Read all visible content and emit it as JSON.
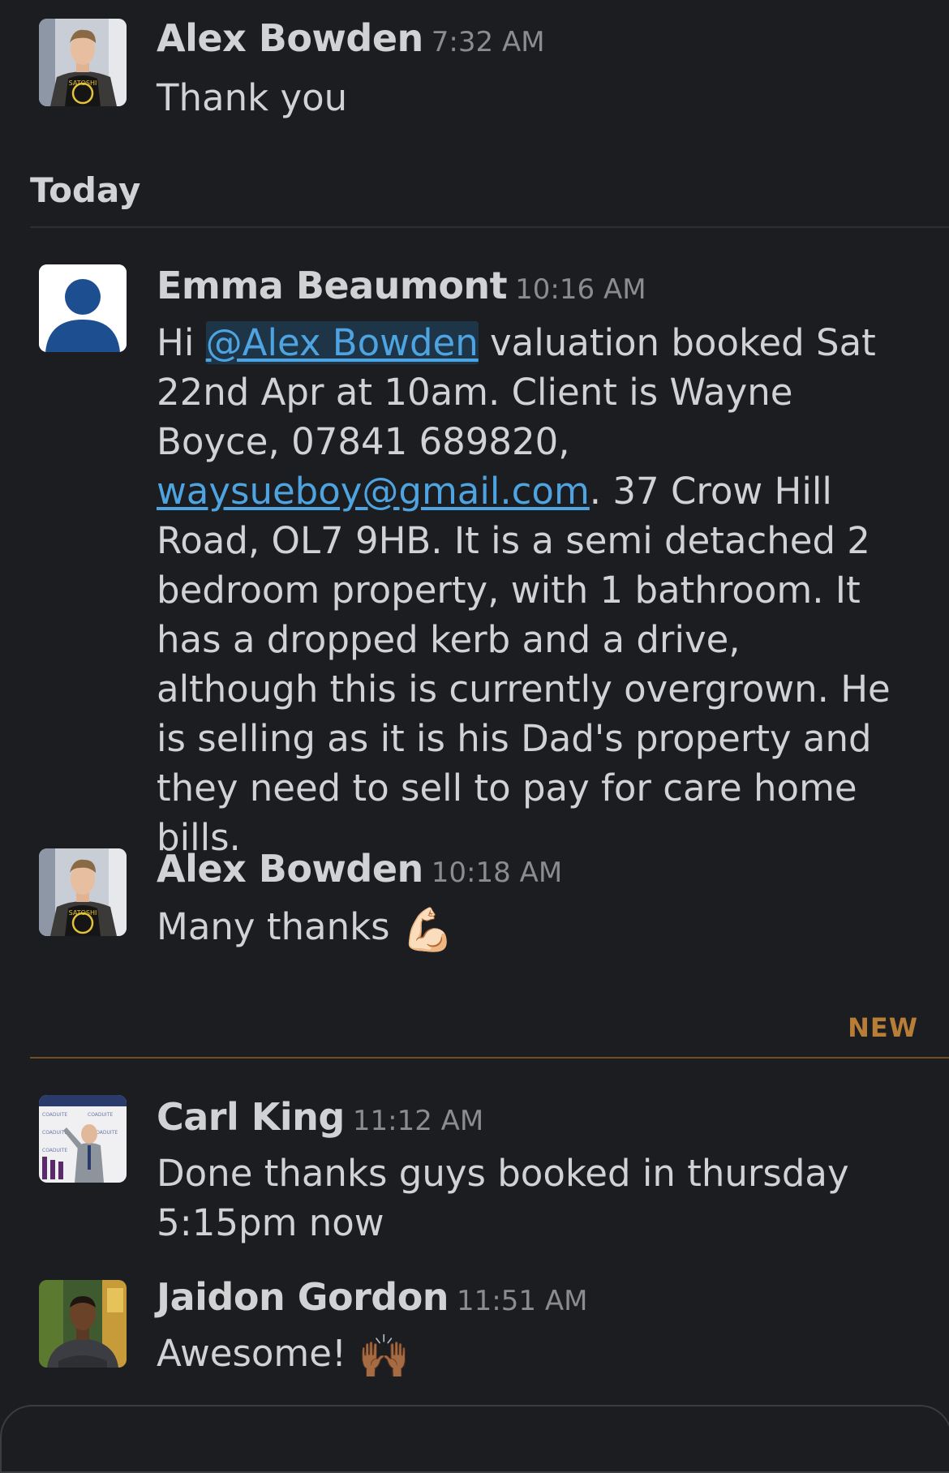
{
  "colors": {
    "background": "#1b1d21",
    "text": "#d1d2d3",
    "timestamp": "#8a8c90",
    "link": "#4ea4e0",
    "mention_bg": "#1e3447",
    "new_divider": "#b87d36"
  },
  "day_separator": {
    "label": "Today"
  },
  "new_separator": {
    "label": "NEW"
  },
  "messages": [
    {
      "sender": "Alex Bowden",
      "time": "7:32 AM",
      "text": "Thank you",
      "avatar": "photo-avatar"
    },
    {
      "sender": "Emma Beaumont",
      "time": "10:16 AM",
      "text_prefix": "Hi ",
      "mention": "@Alex Bowden",
      "text_middle": " valuation booked Sat 22nd Apr at 10am. Client is Wayne Boyce, 07841 689820, ",
      "email": "waysueboy@gmail.com",
      "text_suffix": ". 37 Crow Hill Road, OL7 9HB. It is a semi detached 2 bedroom property, with 1 bathroom. It has a dropped kerb and a drive, although this is currently overgrown. He is selling as it is his Dad's property and they need to sell to pay for care home bills.",
      "avatar": "default-user-icon"
    },
    {
      "sender": "Alex Bowden",
      "time": "10:18 AM",
      "text": "Many thanks",
      "emoji": "💪🏻",
      "emoji_name": "flexed-biceps-icon",
      "avatar": "photo-avatar"
    },
    {
      "sender": "Carl King",
      "time": "11:12 AM",
      "text": "Done thanks guys booked in thursday 5:15pm now",
      "avatar": "photo-avatar"
    },
    {
      "sender": "Jaidon Gordon",
      "time": "11:51 AM",
      "text": "Awesome!",
      "emoji": "🙌🏾",
      "emoji_name": "raising-hands-icon",
      "avatar": "photo-avatar"
    }
  ]
}
